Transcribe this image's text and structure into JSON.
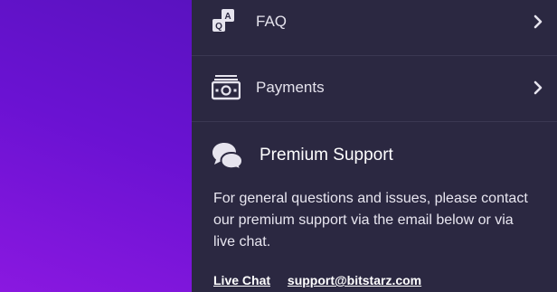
{
  "menu": {
    "items": [
      {
        "label": "FAQ",
        "icon": "faq-icon"
      },
      {
        "label": "Payments",
        "icon": "cash-icon"
      }
    ]
  },
  "support": {
    "title": "Premium Support",
    "icon": "chat-bubbles-icon",
    "description": "For general questions and issues, please contact our premium support via the email below or via live chat.",
    "live_chat_label": "Live Chat",
    "email_label": "support@bitstarz.com"
  },
  "colors": {
    "panel_bg": "#2b2841",
    "left_gradient_start": "#5a12c0",
    "left_gradient_end": "#8a18e0"
  }
}
